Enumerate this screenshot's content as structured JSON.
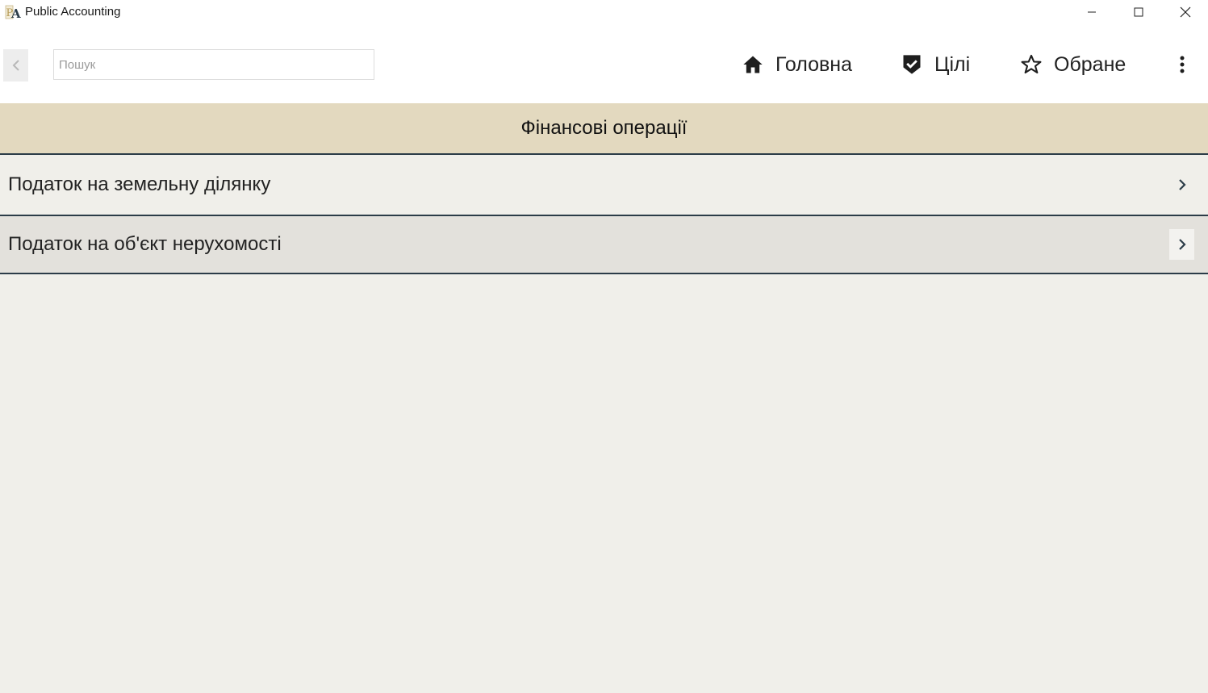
{
  "window": {
    "title": "Public Accounting"
  },
  "toolbar": {
    "search_placeholder": "Пошук",
    "search_value": "",
    "nav": [
      {
        "label": "Головна",
        "icon": "home-icon"
      },
      {
        "label": "Цілі",
        "icon": "shield-check-icon"
      },
      {
        "label": "Обране",
        "icon": "star-outline-icon"
      }
    ]
  },
  "header": {
    "title": "Фінансові операції"
  },
  "list": {
    "items": [
      {
        "label": "Податок на земельну ділянку"
      },
      {
        "label": "Податок на об'єкт нерухомості"
      }
    ]
  },
  "colors": {
    "header_bg": "#e3d9bf",
    "divider": "#2b3c48",
    "page_bg": "#f0efea",
    "row_alt_bg": "#e3e1dc"
  }
}
